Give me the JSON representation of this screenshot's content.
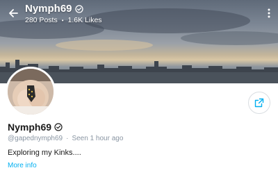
{
  "header": {
    "title": "Nymph69",
    "posts": "280 Posts",
    "separator": "•",
    "likes": "1.6K Likes"
  },
  "profile": {
    "name": "Nymph69",
    "handle": "@gapednymph69",
    "separator": "·",
    "last_seen": "Seen 1 hour ago",
    "bio": "Exploring my Kinks....",
    "more_info": "More info"
  },
  "icons": {
    "back": "arrow-left-icon",
    "verified": "verified-badge-icon",
    "more": "more-vertical-icon",
    "share": "share-icon"
  },
  "colors": {
    "accent": "#00aff0",
    "muted": "#8a96a3",
    "text": "#1a1a1a"
  }
}
